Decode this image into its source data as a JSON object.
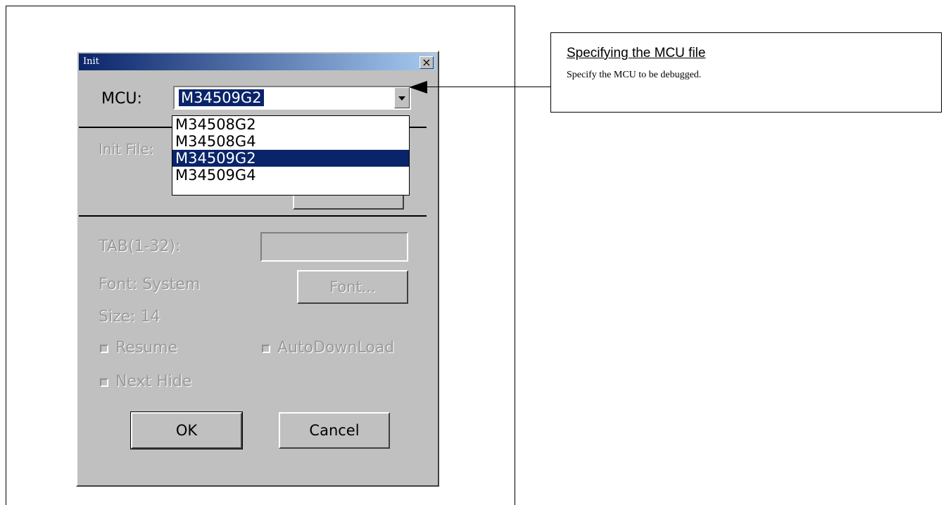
{
  "dialog": {
    "title": "Init",
    "close_label": "×",
    "mcu_label": "MCU:",
    "mcu_selected": "M34509G2",
    "mcu_options": [
      "M34508G2",
      "M34508G4",
      "M34509G2",
      "M34509G4"
    ],
    "init_file_label": "Init File:",
    "tab_label": "TAB(1-32):",
    "tab_value": "",
    "font_info": "Font: System",
    "size_info": "Size:  14",
    "font_button": "Font...",
    "resume_label": "Resume",
    "autodownload_label": "AutoDownLoad",
    "next_hide_label": "Next Hide",
    "ok_button": "OK",
    "cancel_button": "Cancel"
  },
  "callout": {
    "title": "Specifying the MCU file",
    "description": "Specify the MCU to be debugged."
  }
}
